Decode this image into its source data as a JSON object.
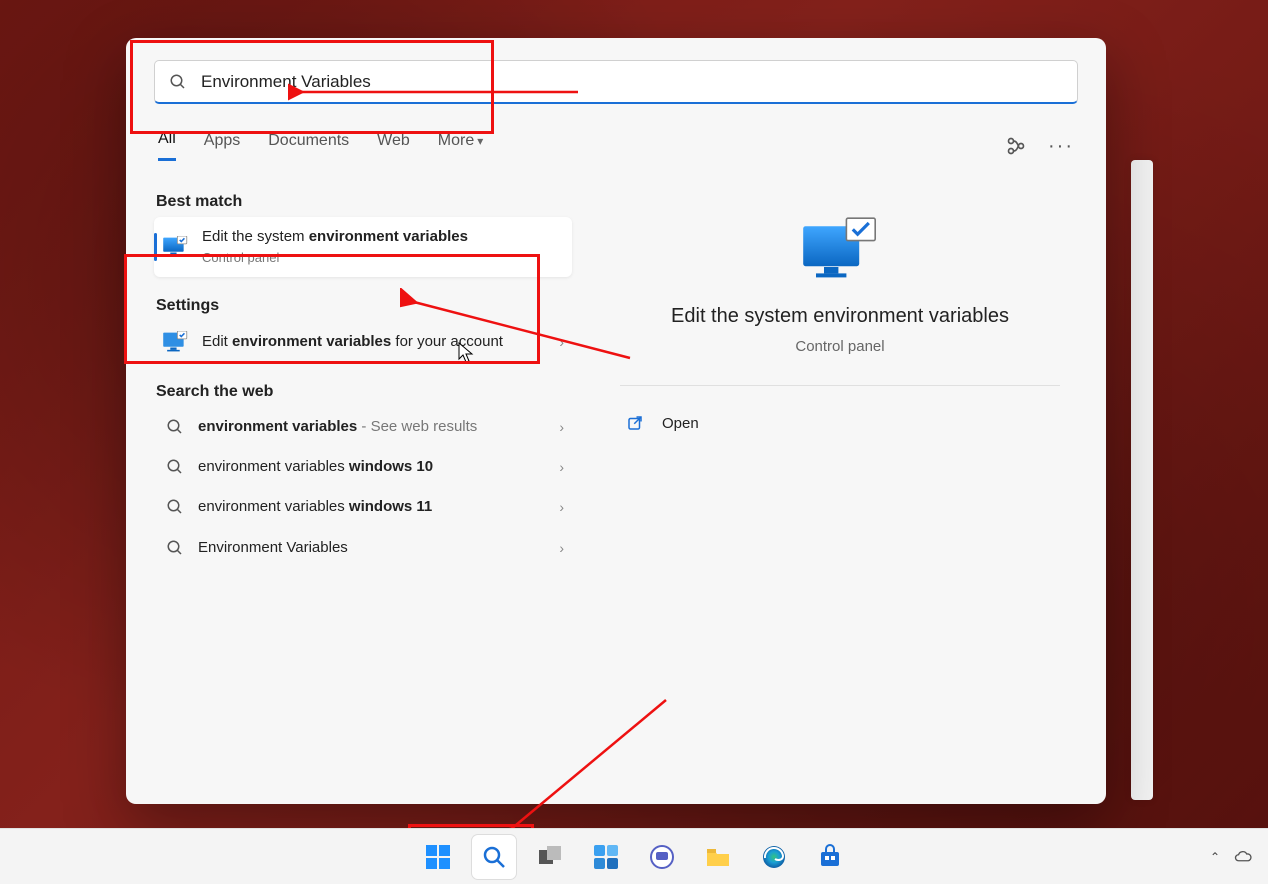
{
  "search": {
    "query": "Environment Variables"
  },
  "tabs": {
    "all": "All",
    "apps": "Apps",
    "documents": "Documents",
    "web": "Web",
    "more": "More"
  },
  "sections": {
    "best_match": "Best match",
    "settings": "Settings",
    "search_web": "Search the web"
  },
  "results": {
    "best": {
      "title_prefix": "Edit the system ",
      "title_bold1": "environment",
      "title_mid": " ",
      "title_bold2": "variables",
      "subtitle": "Control panel"
    },
    "settings_item": {
      "prefix": "Edit ",
      "bold": "environment variables",
      "suffix": " for your account"
    },
    "web": [
      {
        "bold": "environment variables",
        "suffix": " - See web results"
      },
      {
        "prefix": "environment variables ",
        "bold": "windows 10"
      },
      {
        "prefix": "environment variables ",
        "bold": "windows 11"
      },
      {
        "plain": "Environment Variables"
      }
    ]
  },
  "detail": {
    "title": "Edit the system environment variables",
    "subtitle": "Control panel",
    "open": "Open"
  }
}
